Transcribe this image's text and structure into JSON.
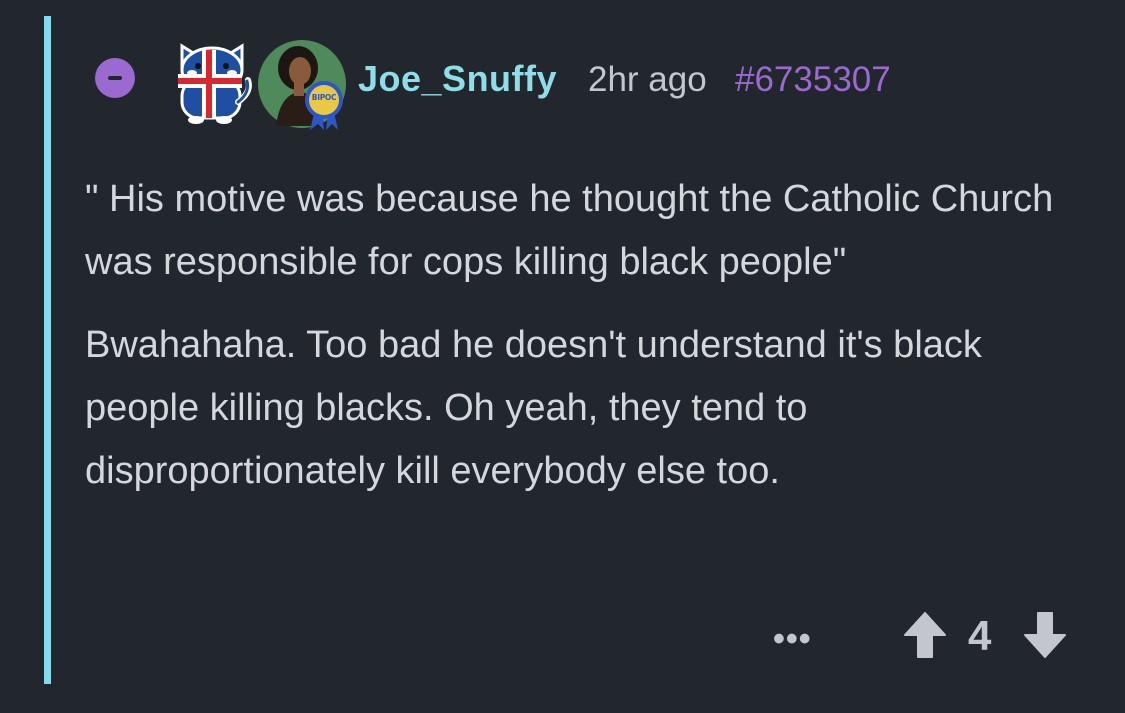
{
  "comment": {
    "username": "Joe_Snuffy",
    "time_ago": "2hr ago",
    "comment_id": "#6735307",
    "badge_text": "BIPOC",
    "paragraphs": [
      "\" His motive was because he thought the Catholic Church was responsible for cops killing black people\"",
      "Bwahahaha. Too bad he doesn't understand it's black people killing blacks. Oh yeah, they tend to disproportionately kill everybody else too."
    ],
    "more_label": "•••",
    "score": "4",
    "icons": {
      "collapse": "minus-icon",
      "flag_avatar": "iceland-flag-cat-icon",
      "avatar": "user-avatar-with-badge",
      "upvote": "arrow-up-icon",
      "downvote": "arrow-down-icon"
    }
  },
  "colors": {
    "background": "#22262d",
    "thread_line": "#84dcea",
    "accent_purple": "#9a6ad0",
    "username": "#8fdde8",
    "text": "#d4d7dc",
    "muted": "#c3c7cd"
  }
}
